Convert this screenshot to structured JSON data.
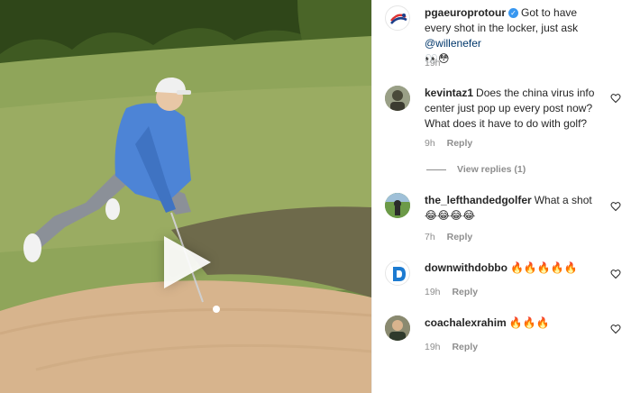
{
  "post": {
    "author": "pgaeuroprotour",
    "caption": "Got to have every shot in the locker, just ask",
    "mention": "@willenefer",
    "caption_emojis": "👀😳",
    "time": "19h"
  },
  "comments": [
    {
      "user": "kevintaz1",
      "text": "Does the china virus info center just pop up every post now? What does it have to do with golf?",
      "time": "9h",
      "reply_label": "Reply",
      "view_replies": "View replies (1)"
    },
    {
      "user": "the_lefthandedgolfer",
      "text": "What a shot",
      "emojis": "😂😂😂😂",
      "time": "7h",
      "reply_label": "Reply"
    },
    {
      "user": "downwithdobbo",
      "text": "",
      "emojis": "🔥🔥🔥🔥🔥",
      "time": "19h",
      "reply_label": "Reply"
    },
    {
      "user": "coachalexrahim",
      "text": "",
      "emojis": "🔥🔥🔥",
      "time": "19h",
      "reply_label": "Reply"
    }
  ],
  "icons": {
    "play": "play-icon",
    "like": "heart-icon",
    "verified": "verified-badge-icon"
  },
  "colors": {
    "username": "#262626",
    "mention": "#00376b",
    "meta": "#8e8e8e",
    "verified": "#3897f0"
  }
}
